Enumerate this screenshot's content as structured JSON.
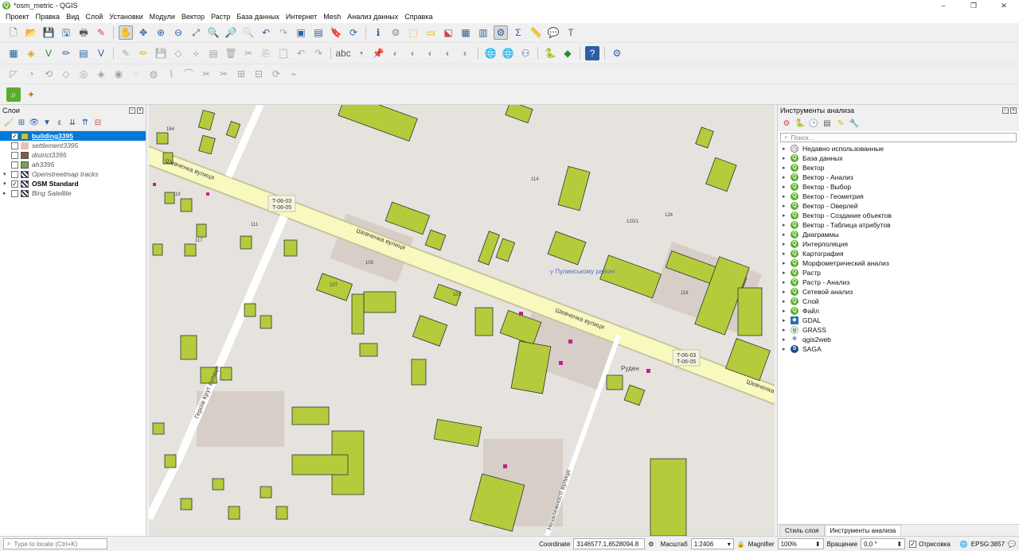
{
  "window": {
    "title": "*osm_metric - QGIS",
    "controls": [
      "–",
      "❐",
      "✕"
    ]
  },
  "menu": [
    "Проект",
    "Правка",
    "Вид",
    "Слой",
    "Установки",
    "Модули",
    "Вектор",
    "Растр",
    "База данных",
    "Интернет",
    "Mesh",
    "Анализ данных",
    "Справка"
  ],
  "layers_panel": {
    "title": "Слои",
    "layers": [
      {
        "name": "building3395",
        "checked": true,
        "selected": true,
        "expand": "",
        "swatch": "#b4cc3c",
        "style": "bold-underline"
      },
      {
        "name": "settlement3395",
        "checked": false,
        "selected": false,
        "expand": "",
        "swatch": "#e8c2b8",
        "style": "italic"
      },
      {
        "name": "district3395",
        "checked": false,
        "selected": false,
        "expand": "",
        "swatch": "#8a5a3a",
        "style": "italic"
      },
      {
        "name": "ah3395",
        "checked": false,
        "selected": false,
        "expand": "",
        "swatch": "#6fa84a",
        "style": "italic"
      },
      {
        "name": "Openstreetmap tracks",
        "checked": false,
        "selected": false,
        "expand": "▾",
        "swatch": "grid",
        "style": "italic"
      },
      {
        "name": "OSM Standard",
        "checked": true,
        "selected": false,
        "expand": "▾",
        "swatch": "grid",
        "style": "bold"
      },
      {
        "name": "Bing Satellite",
        "checked": false,
        "selected": false,
        "expand": "▸",
        "swatch": "grid",
        "style": "italic"
      }
    ]
  },
  "map": {
    "labels": [
      "Шевченка вулиця",
      "Шевченка вулиця",
      "Шевченка вулиця",
      "Шевченка",
      "Героїв Крут вулиця",
      "Незалежності вулиця",
      "Руден",
      "у Пулинському районі"
    ],
    "route_labels": [
      "T-06-03",
      "T-06-05",
      "T-06-03",
      "T-06-05"
    ],
    "numbers": [
      "164",
      "119",
      "117",
      "111",
      "105",
      "107",
      "101",
      "124",
      "120/1",
      "116",
      "114"
    ],
    "road_color": "#f7f9bf",
    "building_color": "#b4cc3c",
    "bg_color": "#e6e2dd"
  },
  "processing_panel": {
    "title": "Инструменты анализа",
    "search_placeholder": "Поиск...",
    "items": [
      {
        "label": "Недавно использованные",
        "icon": "clock-icon"
      },
      {
        "label": "База данных",
        "icon": "qgis-icon"
      },
      {
        "label": "Вектор",
        "icon": "qgis-icon"
      },
      {
        "label": "Вектор - Анализ",
        "icon": "qgis-icon"
      },
      {
        "label": "Вектор - Выбор",
        "icon": "qgis-icon"
      },
      {
        "label": "Вектор - Геометрия",
        "icon": "qgis-icon"
      },
      {
        "label": "Вектор - Оверлей",
        "icon": "qgis-icon"
      },
      {
        "label": "Вектор - Создание объектов",
        "icon": "qgis-icon"
      },
      {
        "label": "Вектор - Таблица атрибутов",
        "icon": "qgis-icon"
      },
      {
        "label": "Диаграммы",
        "icon": "qgis-icon"
      },
      {
        "label": "Интерполяция",
        "icon": "qgis-icon"
      },
      {
        "label": "Картография",
        "icon": "qgis-icon"
      },
      {
        "label": "Морфометрический анализ",
        "icon": "qgis-icon"
      },
      {
        "label": "Растр",
        "icon": "qgis-icon"
      },
      {
        "label": "Растр - Анализ",
        "icon": "qgis-icon"
      },
      {
        "label": "Сетевой анализ",
        "icon": "qgis-icon"
      },
      {
        "label": "Слой",
        "icon": "qgis-icon"
      },
      {
        "label": "Файл",
        "icon": "qgis-icon"
      },
      {
        "label": "GDAL",
        "icon": "gdal-icon"
      },
      {
        "label": "GRASS",
        "icon": "grass-icon"
      },
      {
        "label": "qgis2web",
        "icon": "gear-icon"
      },
      {
        "label": "SAGA",
        "icon": "saga-icon"
      }
    ],
    "tabs": [
      "Стиль слоя",
      "Инструменты анализа"
    ]
  },
  "statusbar": {
    "locate_placeholder": "Type to locate (Ctrl+K)",
    "coordinate_label": "Coordinate",
    "coordinate_value": "3146577.1,6528094.8",
    "scale_label": "Масштаб",
    "scale_value": "1:2406",
    "magnifier_label": "Magnifier",
    "magnifier_value": "100%",
    "rotation_label": "Вращение",
    "rotation_value": "0,0 °",
    "render_label": "Отрисовка",
    "crs": "EPSG:3857"
  }
}
